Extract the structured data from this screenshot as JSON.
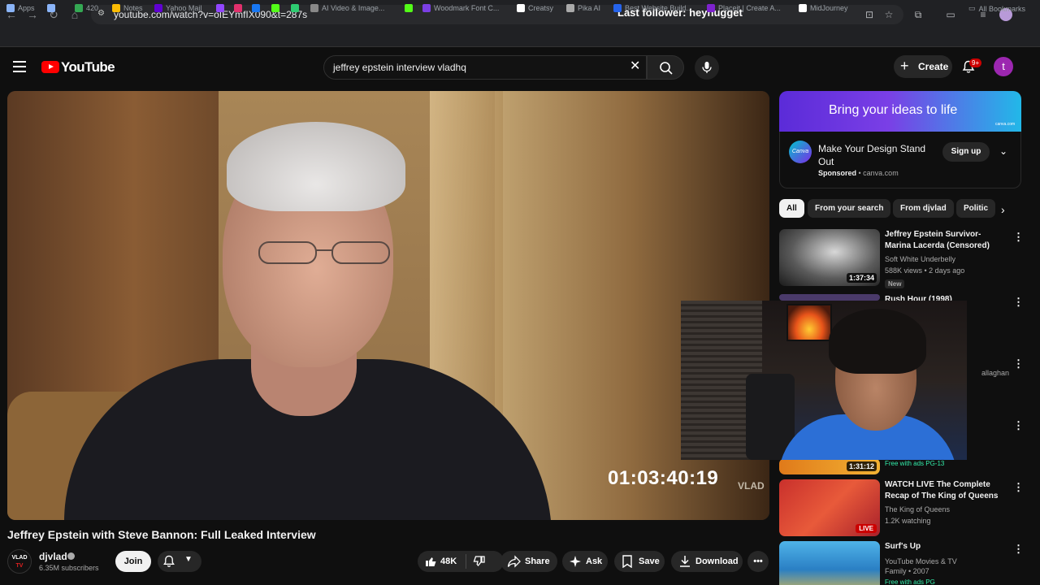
{
  "browser": {
    "url": "youtube.com/watch?v=oIEYmfIX090&t=287s",
    "overlay_text": "Last follower: heynugget",
    "bookmarks": [
      {
        "label": "Apps",
        "color": "#8ab4f8"
      },
      {
        "label": "",
        "color": "#8ab4f8"
      },
      {
        "label": "420",
        "color": "#34a853"
      },
      {
        "label": "Notes",
        "color": "#fbbc04"
      },
      {
        "label": "Yahoo Mail",
        "color": "#6001d2"
      },
      {
        "label": "",
        "color": "#9146ff"
      },
      {
        "label": "",
        "color": "#e1306c"
      },
      {
        "label": "",
        "color": "#1877f2"
      },
      {
        "label": "",
        "color": "#53fc18"
      },
      {
        "label": "",
        "color": "#2ecc71"
      },
      {
        "label": "AI Video & Image...",
        "color": "#888888"
      },
      {
        "label": "",
        "color": "#53fc18"
      },
      {
        "label": "Woodmark Font C...",
        "color": "#7b3fe4"
      },
      {
        "label": "Creatsy",
        "color": "#ffffff"
      },
      {
        "label": "Pika AI",
        "color": "#aaaaaa"
      },
      {
        "label": "Best Website Build...",
        "color": "#2563eb"
      },
      {
        "label": "Placeit | Create A...",
        "color": "#7e22ce"
      },
      {
        "label": "MidJourney",
        "color": "#ffffff"
      }
    ],
    "all_bookmarks": "All Bookmarks"
  },
  "header": {
    "logo_text": "YouTube",
    "search_value": "jeffrey epstein interview vladhq",
    "create_label": "Create",
    "notif_badge": "9+",
    "avatar_letter": "t"
  },
  "video": {
    "timestamp_overlay": "01:03:40:19",
    "watermark": "VLAD",
    "title": "Jeffrey Epstein with Steve Bannon: Full Leaked Interview",
    "channel": "djvlad",
    "channel_avatar_top": "VLAD",
    "channel_avatar_bottom": "TV",
    "subscribers": "6.35M subscribers",
    "join_label": "Join",
    "like_count": "48K",
    "share_label": "Share",
    "ask_label": "Ask",
    "save_label": "Save",
    "download_label": "Download"
  },
  "ad": {
    "banner_text": "Bring your ideas to life",
    "canva_tag": "canva.com",
    "logo_text": "Canva",
    "title": "Make Your Design Stand Out",
    "sponsored": "Sponsored",
    "domain": " • canva.com",
    "cta": "Sign up"
  },
  "chips": [
    "All",
    "From your search",
    "From djvlad",
    "Politic"
  ],
  "recommendations": [
    {
      "title": "Jeffrey Epstein Survivor-Marina Lacerda (Censored)",
      "channel": "Soft White Underbelly",
      "meta": "588K views • 2 days ago",
      "duration": "1:37:34",
      "badge": "New"
    },
    {
      "title": "Rush Hour (1998)",
      "channel": "",
      "meta": "",
      "duration": "",
      "badge": ""
    },
    {
      "title": "",
      "channel": "allaghan",
      "meta": "",
      "duration": "",
      "badge": ""
    },
    {
      "title": "",
      "channel": "",
      "meta": "",
      "duration": "1:31:12",
      "badge": "Free with ads  PG-13"
    },
    {
      "title": "WATCH LIVE The Complete Recap of The King of Queens",
      "channel": "The King of Queens",
      "meta": "1.2K watching",
      "duration": "LIVE",
      "badge": ""
    },
    {
      "title": "Surf's Up",
      "channel": "YouTube Movies & TV",
      "meta": "Family • 2007",
      "duration": "",
      "badge": "Free with ads  PG"
    }
  ]
}
